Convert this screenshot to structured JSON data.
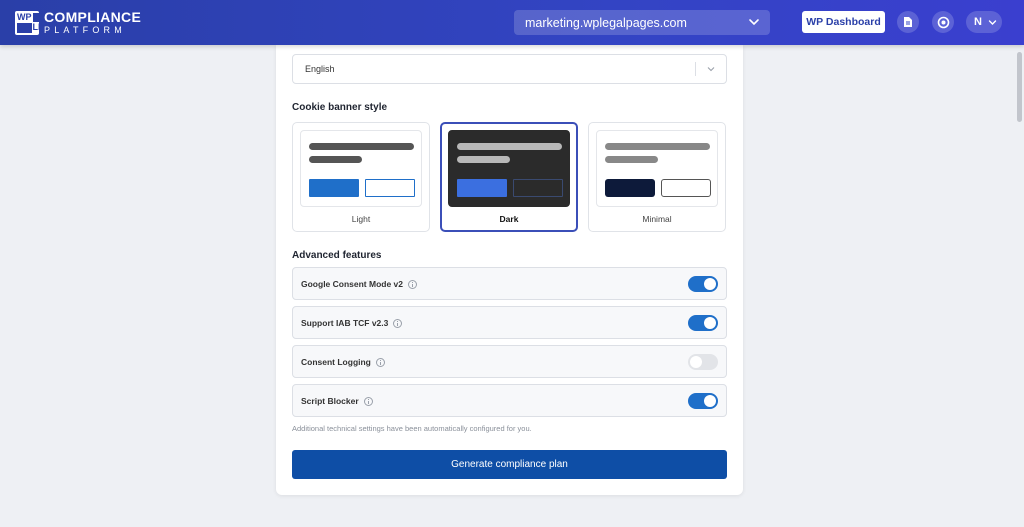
{
  "header": {
    "logo_cells": [
      "WP",
      "LP"
    ],
    "logo_line1": "COMPLIANCE",
    "logo_line2": "PLATFORM",
    "site_select_value": "marketing.wplegalpages.com",
    "wp_dashboard_label": "WP Dashboard",
    "user_initial": "N",
    "icons": [
      "document-icon",
      "help-support-icon",
      "chevron-down-icon"
    ]
  },
  "language": {
    "selected": "English"
  },
  "cookie_banner": {
    "title": "Cookie banner style",
    "options": [
      {
        "label": "Light",
        "selected": false,
        "accent": "#1f6fc9"
      },
      {
        "label": "Dark",
        "selected": true,
        "accent": "#3b6fe0"
      },
      {
        "label": "Minimal",
        "selected": false,
        "accent": "#0d1a3a"
      }
    ]
  },
  "advanced": {
    "title": "Advanced features",
    "features": [
      {
        "label": "Google Consent Mode v2",
        "enabled": true
      },
      {
        "label": "Support IAB TCF v2.3",
        "enabled": true
      },
      {
        "label": "Consent Logging",
        "enabled": false
      },
      {
        "label": "Script Blocker",
        "enabled": true
      }
    ],
    "note": "Additional technical settings have been automatically configured for you."
  },
  "actions": {
    "generate_label": "Generate compliance plan"
  },
  "colors": {
    "header": "#3344c4",
    "primary_button": "#0e4ea6",
    "toggle_on": "#1f6fc9",
    "selected_border": "#3b4fb8"
  }
}
